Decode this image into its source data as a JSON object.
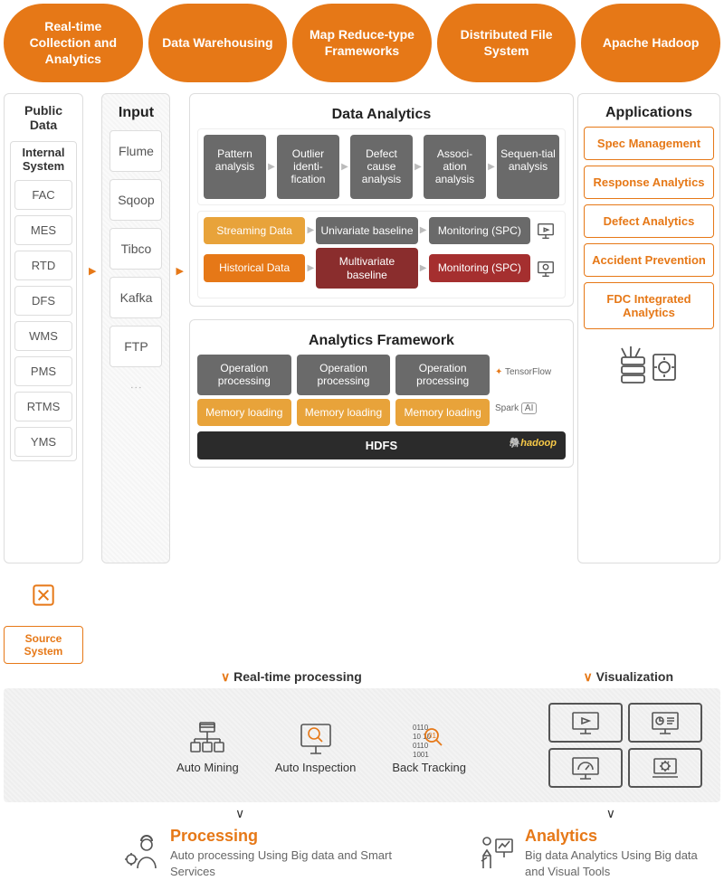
{
  "pills": [
    "Real-time Collection and Analytics",
    "Data Warehousing",
    "Map Reduce-type Frameworks",
    "Distributed File System",
    "Apache Hadoop"
  ],
  "publicData": {
    "title": "Public Data",
    "internalTitle": "Internal System",
    "systems": [
      "FAC",
      "MES",
      "RTD",
      "DFS",
      "WMS",
      "PMS",
      "RTMS",
      "YMS"
    ]
  },
  "sourceSystem": "Source System",
  "input": {
    "title": "Input",
    "items": [
      "Flume",
      "Sqoop",
      "Tibco",
      "Kafka",
      "FTP"
    ]
  },
  "dataAnalytics": {
    "title": "Data Analytics",
    "pipeline": [
      "Pattern analysis",
      "Outlier identi-fication",
      "Defect cause analysis",
      "Associ-ation analysis",
      "Sequen-tial analysis"
    ],
    "stream1": [
      "Streaming Data",
      "Univariate baseline",
      "Monitoring (SPC)"
    ],
    "stream2": [
      "Historical Data",
      "Multivariate baseline",
      "Monitoring (SPC)"
    ]
  },
  "analyticsFramework": {
    "title": "Analytics Framework",
    "topRow": [
      "Operation processing",
      "Operation processing",
      "Operation processing"
    ],
    "bottomRow": [
      "Memory loading",
      "Memory loading",
      "Memory loading"
    ],
    "side": [
      "TensorFlow",
      "Spark",
      "AI"
    ],
    "hdfs": "HDFS",
    "hadoop": "hadoop"
  },
  "applications": {
    "title": "Applications",
    "items": [
      "Spec Management",
      "Response Analytics",
      "Defect Analytics",
      "Accident Prevention",
      "FDC Integrated Analytics"
    ]
  },
  "lowerLabels": {
    "left": "Real-time processing",
    "right": "Visualization"
  },
  "bandItems": [
    "Auto Mining",
    "Auto Inspection",
    "Back Tracking"
  ],
  "results": {
    "processing": {
      "title": "Processing",
      "desc": "Auto processing Using Big data and Smart Services"
    },
    "analytics": {
      "title": "Analytics",
      "desc": "Big data Analytics Using Big data and Visual Tools"
    }
  }
}
